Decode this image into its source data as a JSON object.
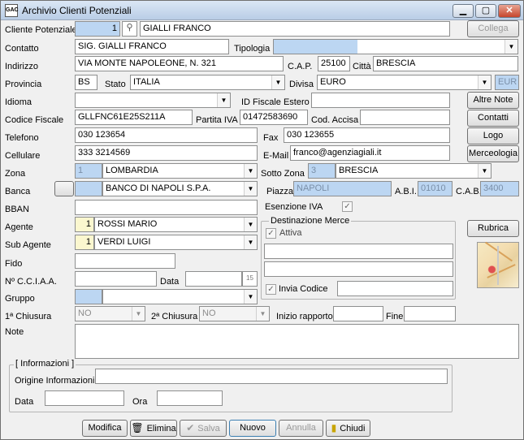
{
  "window": {
    "title": "Archivio Clienti Potenziali",
    "icon_text": "GAC"
  },
  "labels": {
    "cliente_potenziale": "Cliente Potenziale",
    "contatto": "Contatto",
    "tipologia": "Tipologia",
    "indirizzo": "Indirizzo",
    "cap": "C.A.P.",
    "citta": "Città",
    "provincia": "Provincia",
    "stato": "Stato",
    "divisa": "Divisa",
    "idioma": "Idioma",
    "id_fiscale_estero": "ID Fiscale Estero",
    "codice_fiscale": "Codice Fiscale",
    "partita_iva": "Partita IVA",
    "cod_accisa": "Cod. Accisa",
    "telefono": "Telefono",
    "fax": "Fax",
    "cellulare": "Cellulare",
    "email": "E-Mail",
    "zona": "Zona",
    "sotto_zona": "Sotto Zona",
    "banca": "Banca",
    "piazza": "Piazza",
    "abi": "A.B.I.",
    "cab": "C.A.B.",
    "bban": "BBAN",
    "esenzione_iva": "Esenzione IVA",
    "agente": "Agente",
    "sub_agente": "Sub Agente",
    "fido": "Fido",
    "ncciaa": "Nº C.C.I.A.A.",
    "data": "Data",
    "gruppo": "Gruppo",
    "chiusura1": "1ª Chiusura",
    "chiusura2": "2ª Chiusura",
    "inizio_rapporto": "Inizio rapporto",
    "fine": "Fine",
    "note": "Note",
    "destinazione_merce": "Destinazione Merce",
    "attiva": "Attiva",
    "invia_codice": "Invia Codice",
    "informazioni": "[ Informazioni ]",
    "origine_informazioni": "Origine Informazioni",
    "info_data": "Data",
    "info_ora": "Ora"
  },
  "values": {
    "cliente_code": "1",
    "cliente_name": "GIALLI FRANCO",
    "contatto": "SIG. GIALLI FRANCO",
    "tipologia": "",
    "indirizzo": "VIA MONTE NAPOLEONE, N. 321",
    "cap": "25100",
    "citta": "BRESCIA",
    "provincia": "BS",
    "stato": "ITALIA",
    "divisa": "EURO",
    "divisa_code": "EUR",
    "idioma": "",
    "id_fiscale_estero": "",
    "codice_fiscale": "GLLFNC61E25S211A",
    "partita_iva": "01472583690",
    "cod_accisa": "",
    "telefono": "030 123654",
    "fax": "030 123655",
    "cellulare": "333 3214569",
    "email": "franco@agenziagiali.it",
    "zona_code": "1",
    "zona": "LOMBARDIA",
    "sotto_zona_code": "3",
    "sotto_zona": "BRESCIA",
    "banca_code": "",
    "banca": "BANCO DI NAPOLI S.P.A.",
    "piazza": "NAPOLI",
    "abi": "01010",
    "cab": "3400",
    "bban": "",
    "agente_code": "1",
    "agente": "ROSSI MARIO",
    "sub_agente_code": "1",
    "sub_agente": "VERDI LUIGI",
    "fido": "",
    "ncciaa": "",
    "data_cciaa_cal": "15",
    "gruppo_code": "",
    "gruppo": "",
    "chiusura1": "NO",
    "chiusura2": "NO",
    "inizio_rapporto": "",
    "fine": "",
    "note": ""
  },
  "buttons": {
    "collega": "Collega",
    "altre_note": "Altre Note",
    "contatti": "Contatti",
    "logo": "Logo",
    "merceologia": "Merceologia",
    "rubrica": "Rubrica",
    "modifica": "Modifica",
    "elimina": "Elimina",
    "salva": "Salva",
    "nuovo": "Nuovo",
    "annulla": "Annulla",
    "chiudi": "Chiudi"
  },
  "icons": {
    "minimize": "minimize-icon",
    "maximize": "maximize-icon",
    "close": "close-icon",
    "dropdown": "chevron-down-icon",
    "check": "check-icon"
  }
}
